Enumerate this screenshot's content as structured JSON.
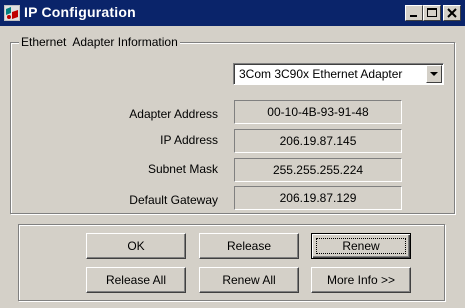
{
  "window": {
    "title": "IP Configuration",
    "icon": "network-config-icon",
    "controls": {
      "minimize": "minimize-icon",
      "maximize": "maximize-icon",
      "close": "close-icon"
    }
  },
  "adapter_group": {
    "legend": "Ethernet  Adapter Information",
    "adapter_select": {
      "selected": "3Com 3C90x Ethernet Adapter"
    },
    "fields": [
      {
        "label": "Adapter Address",
        "value": "00-10-4B-93-91-48"
      },
      {
        "label": "IP Address",
        "value": "206.19.87.145"
      },
      {
        "label": "Subnet Mask",
        "value": "255.255.255.224"
      },
      {
        "label": "Default Gateway",
        "value": "206.19.87.129"
      }
    ]
  },
  "buttons": {
    "ok": "OK",
    "release": "Release",
    "renew": "Renew",
    "release_all": "Release All",
    "renew_all": "Renew All",
    "more_info": "More Info >>"
  },
  "colors": {
    "titlebar": "#0a246a",
    "face": "#d4d0c8"
  }
}
